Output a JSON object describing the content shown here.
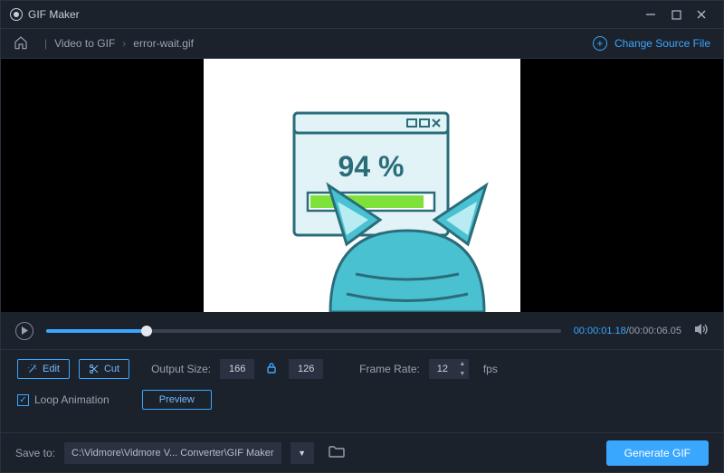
{
  "titlebar": {
    "appname": "GIF Maker"
  },
  "breadcrumb": {
    "section": "Video to GIF",
    "file": "error-wait.gif",
    "change_source": "Change Source File"
  },
  "preview": {
    "percent_text": "94 %"
  },
  "timeline": {
    "current": "00:00:01.18",
    "total": "00:00:06.05"
  },
  "controls": {
    "edit": "Edit",
    "cut": "Cut",
    "output_size_label": "Output Size:",
    "width": "166",
    "height": "126",
    "frame_rate_label": "Frame Rate:",
    "fps": "12",
    "fps_unit": "fps",
    "loop": "Loop Animation",
    "preview": "Preview"
  },
  "footer": {
    "save_to_label": "Save to:",
    "path": "C:\\Vidmore\\Vidmore V... Converter\\GIF Maker",
    "generate": "Generate GIF"
  }
}
